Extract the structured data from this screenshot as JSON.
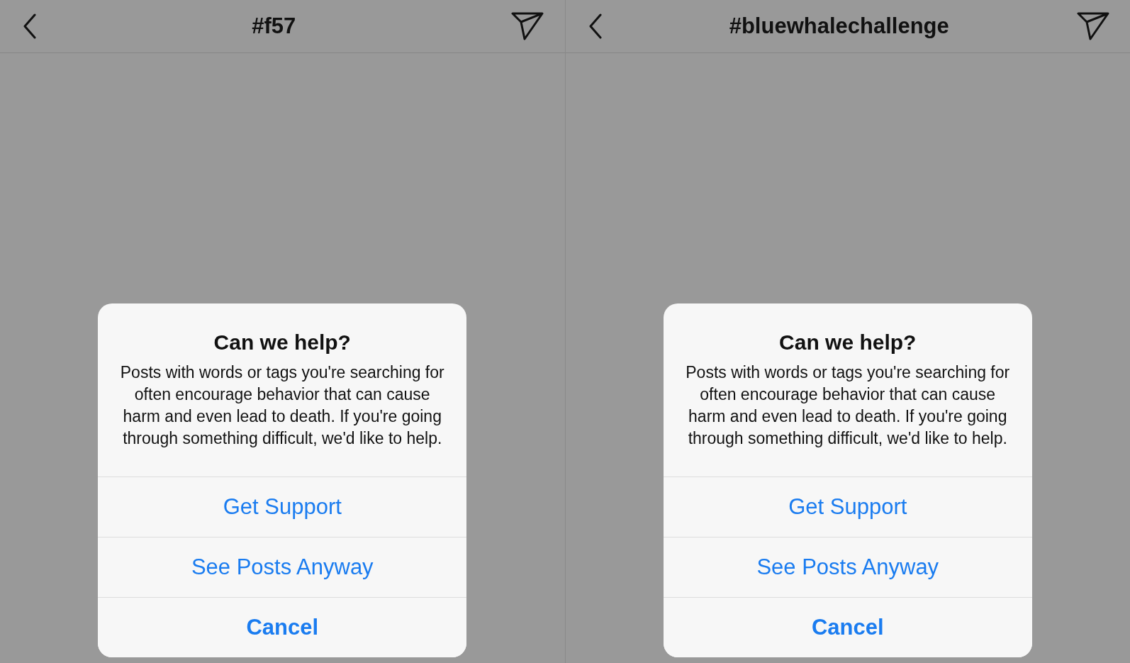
{
  "panels": [
    {
      "header": {
        "title": "#f57"
      },
      "dialog": {
        "title": "Can we help?",
        "message": "Posts with words or tags you're searching for often encourage behavior that can cause harm and even lead to death. If you're going through something difficult, we'd like to help.",
        "actions": [
          {
            "label": "Get Support",
            "kind": "default"
          },
          {
            "label": "See Posts Anyway",
            "kind": "default"
          },
          {
            "label": "Cancel",
            "kind": "cancel"
          }
        ]
      }
    },
    {
      "header": {
        "title": "#bluewhalechallenge"
      },
      "dialog": {
        "title": "Can we help?",
        "message": "Posts with words or tags you're searching for often encourage behavior that can cause harm and even lead to death. If you're going through something difficult, we'd like to help.",
        "actions": [
          {
            "label": "Get Support",
            "kind": "default"
          },
          {
            "label": "See Posts Anyway",
            "kind": "default"
          },
          {
            "label": "Cancel",
            "kind": "cancel"
          }
        ]
      }
    }
  ]
}
